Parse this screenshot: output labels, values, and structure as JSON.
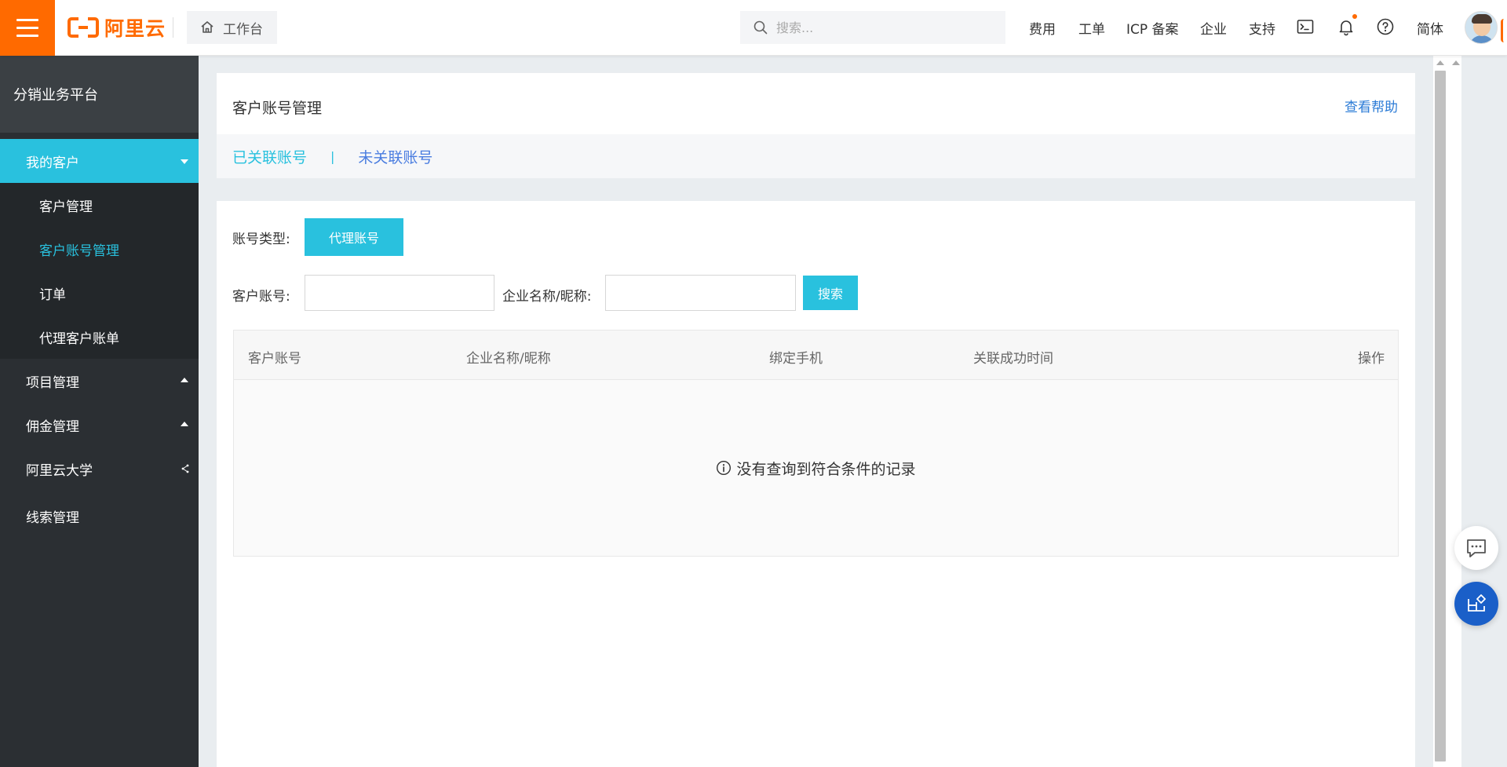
{
  "header": {
    "logo_text": "阿里云",
    "workbench_label": "工作台",
    "search_placeholder": "搜索...",
    "nav": [
      "费用",
      "工单",
      "ICP 备案",
      "企业",
      "支持"
    ],
    "language_label": "简体",
    "icons": [
      "terminal-icon",
      "bell-icon",
      "help-circle-icon"
    ]
  },
  "sidebar": {
    "title": "分销业务平台",
    "groups": [
      {
        "label": "我的客户",
        "expanded": true,
        "active": true,
        "items": [
          "客户管理",
          "客户账号管理",
          "订单",
          "代理客户账单"
        ],
        "current_item": "客户账号管理"
      },
      {
        "label": "项目管理",
        "expanded": false
      },
      {
        "label": "佣金管理",
        "expanded": false
      },
      {
        "label": "阿里云大学",
        "external": true
      },
      {
        "label": "线索管理"
      }
    ]
  },
  "page": {
    "title": "客户账号管理",
    "help_link": "查看帮助",
    "tabs": [
      "已关联账号",
      "未关联账号"
    ],
    "tab_separator": "|"
  },
  "filters": {
    "account_type_label": "账号类型:",
    "account_type_value": "代理账号",
    "customer_account_label": "客户账号:",
    "company_label": "企业名称/昵称:",
    "customer_account_value": "",
    "company_value": "",
    "search_button": "搜索"
  },
  "table": {
    "columns": [
      "客户账号",
      "企业名称/昵称",
      "绑定手机",
      "关联成功时间",
      "操作"
    ],
    "rows": [],
    "empty_text": "没有查询到符合条件的记录"
  },
  "colors": {
    "brand_orange": "#ff6a00",
    "accent_cyan": "#29c1de",
    "link_blue": "#2b7bd6",
    "sidebar_bg": "#2b2f33",
    "float_blue": "#1a5fc8"
  }
}
